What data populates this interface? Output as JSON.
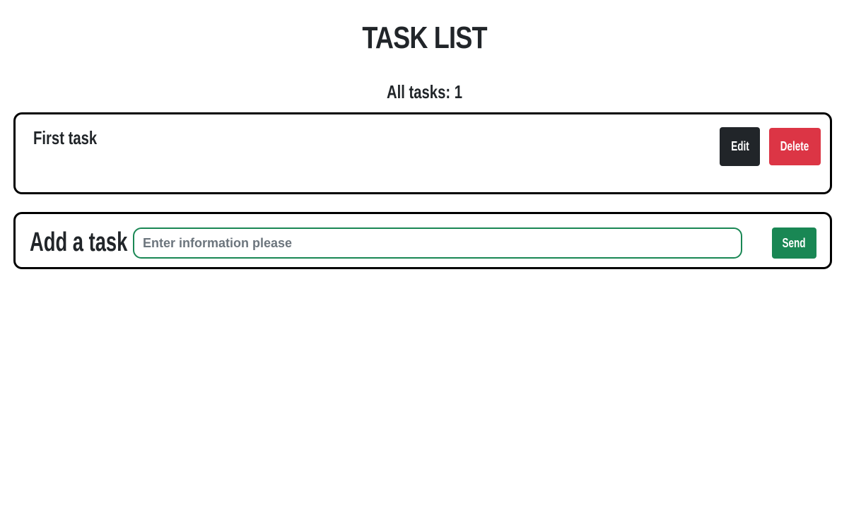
{
  "header": {
    "title": "TASK LIST",
    "count_text": "All tasks: 1"
  },
  "tasks": [
    {
      "text": "First task",
      "edit_label": "Edit",
      "delete_label": "Delete"
    }
  ],
  "add_form": {
    "label": "Add a task",
    "input_value": "",
    "input_placeholder": "Enter information please",
    "send_label": "Send"
  },
  "colors": {
    "text": "#212529",
    "border": "#000000",
    "edit_button": "#212529",
    "delete_button": "#dc3545",
    "send_button": "#198754",
    "input_border": "#198754"
  }
}
